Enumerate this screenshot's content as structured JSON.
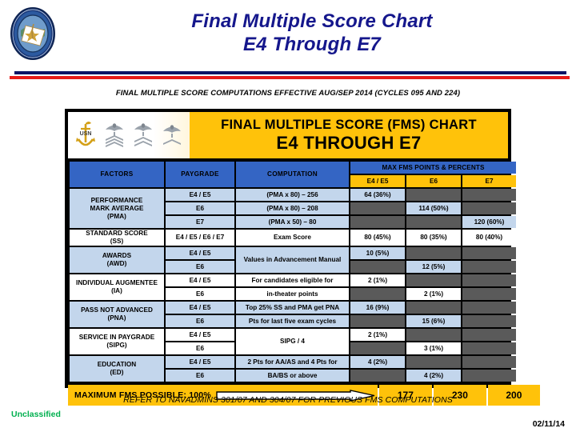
{
  "header": {
    "title_line1": "Final Multiple Score Chart",
    "title_line2": "E4 Through E7",
    "seal_icon": "navy-seal-icon",
    "divider_navy_color": "#0c1466",
    "divider_red_color": "#e81b18",
    "title_color": "#15178c"
  },
  "caption": {
    "effective_note": "FINAL MULTIPLE SCORE COMPUTATIONS EFFECTIVE AUG/SEP 2014 (CYCLES 095 AND 224)"
  },
  "chart": {
    "banner_line1": "FINAL MULTIPLE SCORE (FMS) CHART",
    "banner_line2": "E4 THROUGH E7",
    "banner_bg": "#ffc20a",
    "insignia_icons": [
      "chief-petty-officer-anchor-icon",
      "petty-officer-first-class-crow-icon",
      "petty-officer-second-class-crow-icon",
      "petty-officer-third-class-crow-icon"
    ],
    "headers": {
      "factors": "FACTORS",
      "paygrade": "PAYGRADE",
      "computation": "COMPUTATION",
      "max_group": "MAX FMS POINTS & PERCENTS",
      "col_e4e5": "E4 / E5",
      "col_e6": "E6",
      "col_e7": "E7",
      "header_blue": "#3465c4",
      "header_gold": "#ffc20a"
    },
    "rows": [
      {
        "factor": "PERFORMANCE\nMARK AVERAGE\n(PMA)",
        "factor_l1": "PERFORMANCE",
        "factor_l2": "MARK AVERAGE",
        "factor_l3": "(PMA)",
        "shade": "blue",
        "sub": [
          {
            "paygrade": "E4 / E5",
            "computation": "(PMA x 80) – 256",
            "e4e5": "64 (36%)",
            "e6": "",
            "e7": ""
          },
          {
            "paygrade": "E6",
            "computation": "(PMA x 80) – 208",
            "e4e5": "",
            "e6": "114 (50%)",
            "e7": ""
          },
          {
            "paygrade": "E7",
            "computation": "(PMA x 50) – 80",
            "e4e5": "",
            "e6": "",
            "e7": "120 (60%)"
          }
        ]
      },
      {
        "factor_l1": "STANDARD SCORE",
        "factor_l2": "(SS)",
        "factor_l3": "",
        "shade": "white",
        "sub": [
          {
            "paygrade": "E4 / E5 / E6 / E7",
            "computation": "Exam Score",
            "e4e5": "80 (45%)",
            "e6": "80 (35%)",
            "e7": "80 (40%)"
          }
        ]
      },
      {
        "factor_l1": "AWARDS",
        "factor_l2": "(AWD)",
        "factor_l3": "",
        "shade": "blue",
        "sub": [
          {
            "paygrade": "E4 / E5",
            "computation": "Values in Advancement Manual",
            "e4e5": "10 (5%)",
            "e6": "",
            "e7": ""
          },
          {
            "paygrade": "E6",
            "computation": "",
            "e4e5": "",
            "e6": "12 (5%)",
            "e7": ""
          }
        ]
      },
      {
        "factor_l1": "INDIVIDUAL AUGMENTEE",
        "factor_l2": "(IA)",
        "factor_l3": "",
        "shade": "white",
        "sub": [
          {
            "paygrade": "E4 / E5",
            "computation": "For candidates eligible for",
            "e4e5": "2 (1%)",
            "e6": "",
            "e7": ""
          },
          {
            "paygrade": "E6",
            "computation": "in-theater points",
            "e4e5": "",
            "e6": "2 (1%)",
            "e7": ""
          }
        ]
      },
      {
        "factor_l1": "PASS NOT ADVANCED",
        "factor_l2": "(PNA)",
        "factor_l3": "",
        "shade": "blue",
        "sub": [
          {
            "paygrade": "E4 / E5",
            "computation": "Top 25% SS and PMA get PNA",
            "e4e5": "16 (9%)",
            "e6": "",
            "e7": ""
          },
          {
            "paygrade": "E6",
            "computation": "Pts for last five exam cycles",
            "e4e5": "",
            "e6": "15 (6%)",
            "e7": ""
          }
        ]
      },
      {
        "factor_l1": "SERVICE IN PAYGRADE",
        "factor_l2": "(SIPG)",
        "factor_l3": "",
        "shade": "white",
        "sub": [
          {
            "paygrade": "E4 / E5",
            "computation": "SIPG / 4",
            "e4e5": "2 (1%)",
            "e6": "",
            "e7": ""
          },
          {
            "paygrade": "E6",
            "computation": "",
            "e4e5": "",
            "e6": "3 (1%)",
            "e7": ""
          }
        ]
      },
      {
        "factor_l1": "EDUCATION",
        "factor_l2": "(ED)",
        "factor_l3": "",
        "shade": "blue",
        "sub": [
          {
            "paygrade": "E4 / E5",
            "computation": "2 Pts for AA/AS and 4 Pts for",
            "e4e5": "4 (2%)",
            "e6": "",
            "e7": ""
          },
          {
            "paygrade": "E6",
            "computation": "BA/BS or above",
            "e4e5": "",
            "e6": "4 (2%)",
            "e7": ""
          }
        ]
      }
    ],
    "maximum": {
      "label": "MAXIMUM FMS POSSIBLE:  100%",
      "arrow_icon": "right-arrow-icon",
      "e4e5": "177",
      "e6": "230",
      "e7": "200"
    }
  },
  "footer": {
    "refer_note": "REFER TO NAVADMINS 301/07 AND 304/07 FOR PREVIOUS FMS COMPUTATIONS",
    "classification": "Unclassified",
    "classification_color": "#00b04f",
    "date": "02/11/14"
  }
}
